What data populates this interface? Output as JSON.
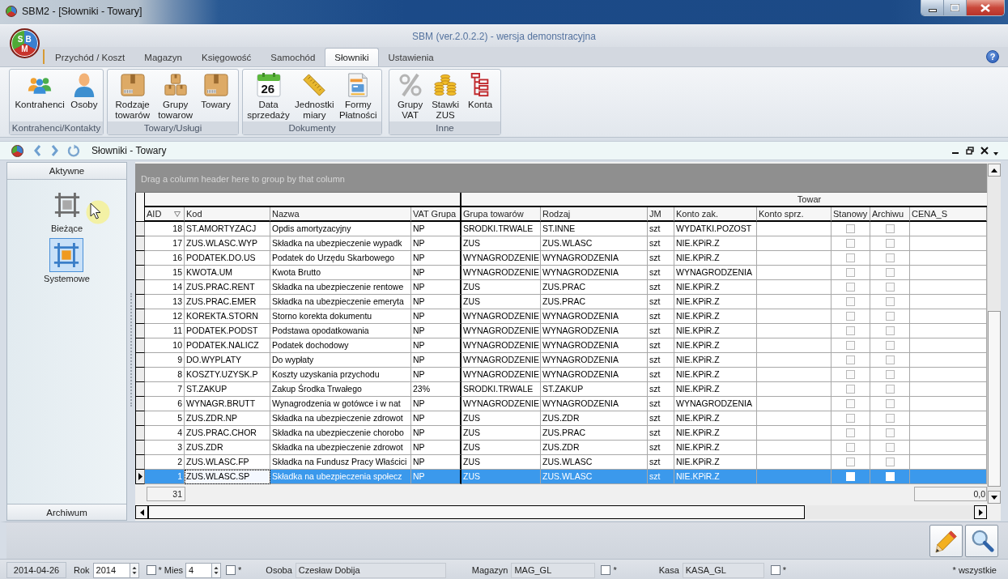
{
  "window": {
    "title": "SBM2 - [Słowniki - Towary]"
  },
  "app_title": "SBM (ver.2.0.2.2) - wersja demonstracyjna",
  "logo": [
    "S",
    "B",
    "M"
  ],
  "help": "?",
  "ribbon": {
    "tabs": [
      {
        "label": "Przychód / Koszt",
        "selected": false
      },
      {
        "label": "Magazyn",
        "selected": false
      },
      {
        "label": "Księgowość",
        "selected": false
      },
      {
        "label": "Samochód",
        "selected": false
      },
      {
        "label": "Słowniki",
        "selected": true
      },
      {
        "label": "Ustawienia",
        "selected": false
      }
    ],
    "groups": [
      {
        "title": "Kontrahenci/Kontakty",
        "items": [
          {
            "label": "Kontrahenci"
          },
          {
            "label": "Osoby"
          }
        ]
      },
      {
        "title": "Towary/Usługi",
        "items": [
          {
            "label": "Rodzaje\ntowarów"
          },
          {
            "label": "Grupy\ntowarow"
          },
          {
            "label": "Towary"
          }
        ]
      },
      {
        "title": "Dokumenty",
        "items": [
          {
            "label": "Data\nsprzedaży",
            "date": "26"
          },
          {
            "label": "Jednostki\nmiary"
          },
          {
            "label": "Formy\nPłatności"
          }
        ]
      },
      {
        "title": "Inne",
        "items": [
          {
            "label": "Grupy\nVAT"
          },
          {
            "label": "Stawki\nZUS"
          },
          {
            "label": "Konta"
          }
        ]
      }
    ]
  },
  "document_bar": {
    "title": "Słowniki - Towary"
  },
  "left_panel": {
    "header": "Aktywne",
    "items": [
      {
        "label": "Bieżące",
        "selected": false
      },
      {
        "label": "Systemowe",
        "selected": true
      }
    ],
    "footer": "Archiwum"
  },
  "grid": {
    "group_panel_hint": "Drag a column header here to group by that column",
    "band": "Towar",
    "columns": [
      {
        "label": "AID",
        "sorted": true
      },
      {
        "label": "Kod",
        "sorted": false
      },
      {
        "label": "Nazwa",
        "sorted": false
      },
      {
        "label": "VAT Grupa",
        "sorted": false
      },
      {
        "label": "Grupa towarów",
        "sorted": false
      },
      {
        "label": "Rodzaj",
        "sorted": false
      },
      {
        "label": "JM",
        "sorted": false
      },
      {
        "label": "Konto zak.",
        "sorted": false
      },
      {
        "label": "Konto sprz.",
        "sorted": false
      },
      {
        "label": "Stanowy",
        "sorted": false
      },
      {
        "label": "Archiwu",
        "sorted": false
      },
      {
        "label": "CENA_S",
        "sorted": false
      }
    ],
    "rows": [
      {
        "aid": "18",
        "kod": "ST.AMORTYZACJ",
        "nazwa": "Opdis amortyzacyjny",
        "vat": "NP",
        "grupa": "SRODKI.TRWALE",
        "rodzaj": "ST.INNE",
        "jm": "szt",
        "konto_zak": "WYDATKI.POZOST",
        "stanowy": false,
        "archiwum": false,
        "selected": false
      },
      {
        "aid": "17",
        "kod": "ZUS.WLASC.WYP",
        "nazwa": "Składka na ubezpieczenie wypadk",
        "vat": "NP",
        "grupa": "ZUS",
        "rodzaj": "ZUS.WLASC",
        "jm": "szt",
        "konto_zak": "NIE.KPiR.Z",
        "stanowy": false,
        "archiwum": false,
        "selected": false
      },
      {
        "aid": "16",
        "kod": "PODATEK.DO.US",
        "nazwa": "Podatek do Urzędu Skarbowego",
        "vat": "NP",
        "grupa": "WYNAGRODZENIE",
        "rodzaj": "WYNAGRODZENIA",
        "jm": "szt",
        "konto_zak": "NIE.KPiR.Z",
        "stanowy": false,
        "archiwum": false,
        "selected": false
      },
      {
        "aid": "15",
        "kod": "KWOTA.UM",
        "nazwa": "Kwota Brutto",
        "vat": "NP",
        "grupa": "WYNAGRODZENIE",
        "rodzaj": "WYNAGRODZENIA",
        "jm": "szt",
        "konto_zak": "WYNAGRODZENIA",
        "stanowy": false,
        "archiwum": false,
        "selected": false
      },
      {
        "aid": "14",
        "kod": "ZUS.PRAC.RENT",
        "nazwa": "Składka na ubezpieczenie rentowe",
        "vat": "NP",
        "grupa": "ZUS",
        "rodzaj": "ZUS.PRAC",
        "jm": "szt",
        "konto_zak": "NIE.KPiR.Z",
        "stanowy": false,
        "archiwum": false,
        "selected": false
      },
      {
        "aid": "13",
        "kod": "ZUS.PRAC.EMER",
        "nazwa": "Składka na ubezpieczenie emeryta",
        "vat": "NP",
        "grupa": "ZUS",
        "rodzaj": "ZUS.PRAC",
        "jm": "szt",
        "konto_zak": "NIE.KPiR.Z",
        "stanowy": false,
        "archiwum": false,
        "selected": false
      },
      {
        "aid": "12",
        "kod": "KOREKTA.STORN",
        "nazwa": "Storno korekta dokumentu",
        "vat": "NP",
        "grupa": "WYNAGRODZENIE",
        "rodzaj": "WYNAGRODZENIA",
        "jm": "szt",
        "konto_zak": "NIE.KPiR.Z",
        "stanowy": false,
        "archiwum": false,
        "selected": false
      },
      {
        "aid": "11",
        "kod": "PODATEK.PODST",
        "nazwa": "Podstawa opodatkowania",
        "vat": "NP",
        "grupa": "WYNAGRODZENIE",
        "rodzaj": "WYNAGRODZENIA",
        "jm": "szt",
        "konto_zak": "NIE.KPiR.Z",
        "stanowy": false,
        "archiwum": false,
        "selected": false
      },
      {
        "aid": "10",
        "kod": "PODATEK.NALICZ",
        "nazwa": "Podatek dochodowy",
        "vat": "NP",
        "grupa": "WYNAGRODZENIE",
        "rodzaj": "WYNAGRODZENIA",
        "jm": "szt",
        "konto_zak": "NIE.KPiR.Z",
        "stanowy": false,
        "archiwum": false,
        "selected": false
      },
      {
        "aid": "9",
        "kod": "DO.WYPLATY",
        "nazwa": "Do wypłaty",
        "vat": "NP",
        "grupa": "WYNAGRODZENIE",
        "rodzaj": "WYNAGRODZENIA",
        "jm": "szt",
        "konto_zak": "NIE.KPiR.Z",
        "stanowy": false,
        "archiwum": false,
        "selected": false
      },
      {
        "aid": "8",
        "kod": "KOSZTY.UZYSK.P",
        "nazwa": "Koszty uzyskania przychodu",
        "vat": "NP",
        "grupa": "WYNAGRODZENIE",
        "rodzaj": "WYNAGRODZENIA",
        "jm": "szt",
        "konto_zak": "NIE.KPiR.Z",
        "stanowy": false,
        "archiwum": false,
        "selected": false
      },
      {
        "aid": "7",
        "kod": "ST.ZAKUP",
        "nazwa": "Zakup Środka Trwałego",
        "vat": "23%",
        "grupa": "SRODKI.TRWALE",
        "rodzaj": "ST.ZAKUP",
        "jm": "szt",
        "konto_zak": "NIE.KPiR.Z",
        "stanowy": false,
        "archiwum": false,
        "selected": false
      },
      {
        "aid": "6",
        "kod": "WYNAGR.BRUTT",
        "nazwa": "Wynagrodzenia w gotówce i w nat",
        "vat": "NP",
        "grupa": "WYNAGRODZENIE",
        "rodzaj": "WYNAGRODZENIA",
        "jm": "szt",
        "konto_zak": "WYNAGRODZENIA",
        "stanowy": false,
        "archiwum": false,
        "selected": false
      },
      {
        "aid": "5",
        "kod": "ZUS.ZDR.NP",
        "nazwa": "Składka na ubezpieczenie zdrowot",
        "vat": "NP",
        "grupa": "ZUS",
        "rodzaj": "ZUS.ZDR",
        "jm": "szt",
        "konto_zak": "NIE.KPiR.Z",
        "stanowy": false,
        "archiwum": false,
        "selected": false
      },
      {
        "aid": "4",
        "kod": "ZUS.PRAC.CHOR",
        "nazwa": "Składka na ubezpieczenie chorobo",
        "vat": "NP",
        "grupa": "ZUS",
        "rodzaj": "ZUS.PRAC",
        "jm": "szt",
        "konto_zak": "NIE.KPiR.Z",
        "stanowy": false,
        "archiwum": false,
        "selected": false
      },
      {
        "aid": "3",
        "kod": "ZUS.ZDR",
        "nazwa": "Składka na ubezpieczenie zdrowot",
        "vat": "NP",
        "grupa": "ZUS",
        "rodzaj": "ZUS.ZDR",
        "jm": "szt",
        "konto_zak": "NIE.KPiR.Z",
        "stanowy": false,
        "archiwum": false,
        "selected": false
      },
      {
        "aid": "2",
        "kod": "ZUS.WLASC.FP",
        "nazwa": "Składka na Fundusz Pracy Właścici",
        "vat": "NP",
        "grupa": "ZUS",
        "rodzaj": "ZUS.WLASC",
        "jm": "szt",
        "konto_zak": "NIE.KPiR.Z",
        "stanowy": false,
        "archiwum": false,
        "selected": false
      },
      {
        "aid": "1",
        "kod": "ZUS.WLASC.SP",
        "nazwa": "Składka na ubezpieczenia społecz",
        "vat": "NP",
        "grupa": "ZUS",
        "rodzaj": "ZUS.WLASC",
        "jm": "szt",
        "konto_zak": "NIE.KPiR.Z",
        "stanowy": false,
        "archiwum": false,
        "selected": true
      }
    ],
    "footer": {
      "count": "31",
      "sum": "0,0"
    }
  },
  "status_bar": {
    "date": "2014-04-26",
    "year_label": "Rok",
    "year_value": "2014",
    "year_all": {
      "label": "*",
      "checked": false
    },
    "month_label": "Mies",
    "month_value": "4",
    "month_all": {
      "label": "*",
      "checked": false
    },
    "person_label": "Osoba",
    "person_value": "Czesław Dobija",
    "warehouse_label": "Magazyn",
    "warehouse_value": "MAG_GL",
    "warehouse_all": {
      "label": "*",
      "checked": false
    },
    "cash_label": "Kasa",
    "cash_value": "KASA_GL",
    "cash_all": {
      "label": "*",
      "checked": false
    },
    "all_note": "* wszystkie"
  }
}
